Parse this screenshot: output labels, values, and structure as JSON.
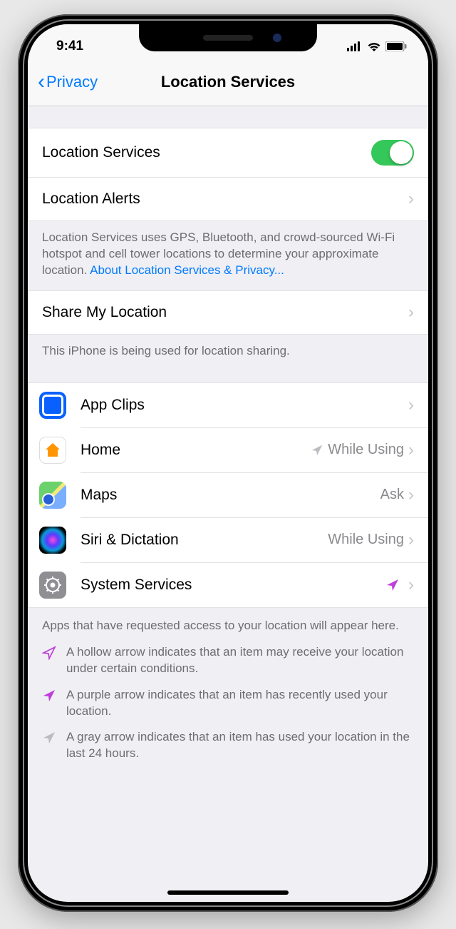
{
  "statusbar": {
    "time": "9:41"
  },
  "nav": {
    "back": "Privacy",
    "title": "Location Services"
  },
  "main_toggle": {
    "label": "Location Services",
    "on": true
  },
  "alerts": {
    "label": "Location Alerts"
  },
  "desc1": "Location Services uses GPS, Bluetooth, and crowd-sourced Wi-Fi hotspot and cell tower locations to determine your approximate location. ",
  "desc1_link": "About Location Services & Privacy...",
  "share": {
    "label": "Share My Location"
  },
  "share_footer": "This iPhone is being used for location sharing.",
  "apps": [
    {
      "name": "App Clips",
      "value": "",
      "arrow": ""
    },
    {
      "name": "Home",
      "value": "While Using",
      "arrow": "gray"
    },
    {
      "name": "Maps",
      "value": "Ask",
      "arrow": ""
    },
    {
      "name": "Siri & Dictation",
      "value": "While Using",
      "arrow": ""
    },
    {
      "name": "System Services",
      "value": "",
      "arrow": "purple"
    }
  ],
  "legend_intro": "Apps that have requested access to your location will appear here.",
  "legend": [
    {
      "type": "hollow",
      "text": "A hollow arrow indicates that an item may receive your location under certain conditions."
    },
    {
      "type": "solid",
      "text": "A purple arrow indicates that an item has recently used your location."
    },
    {
      "type": "gray",
      "text": "A gray arrow indicates that an item has used your location in the last 24 hours."
    }
  ]
}
